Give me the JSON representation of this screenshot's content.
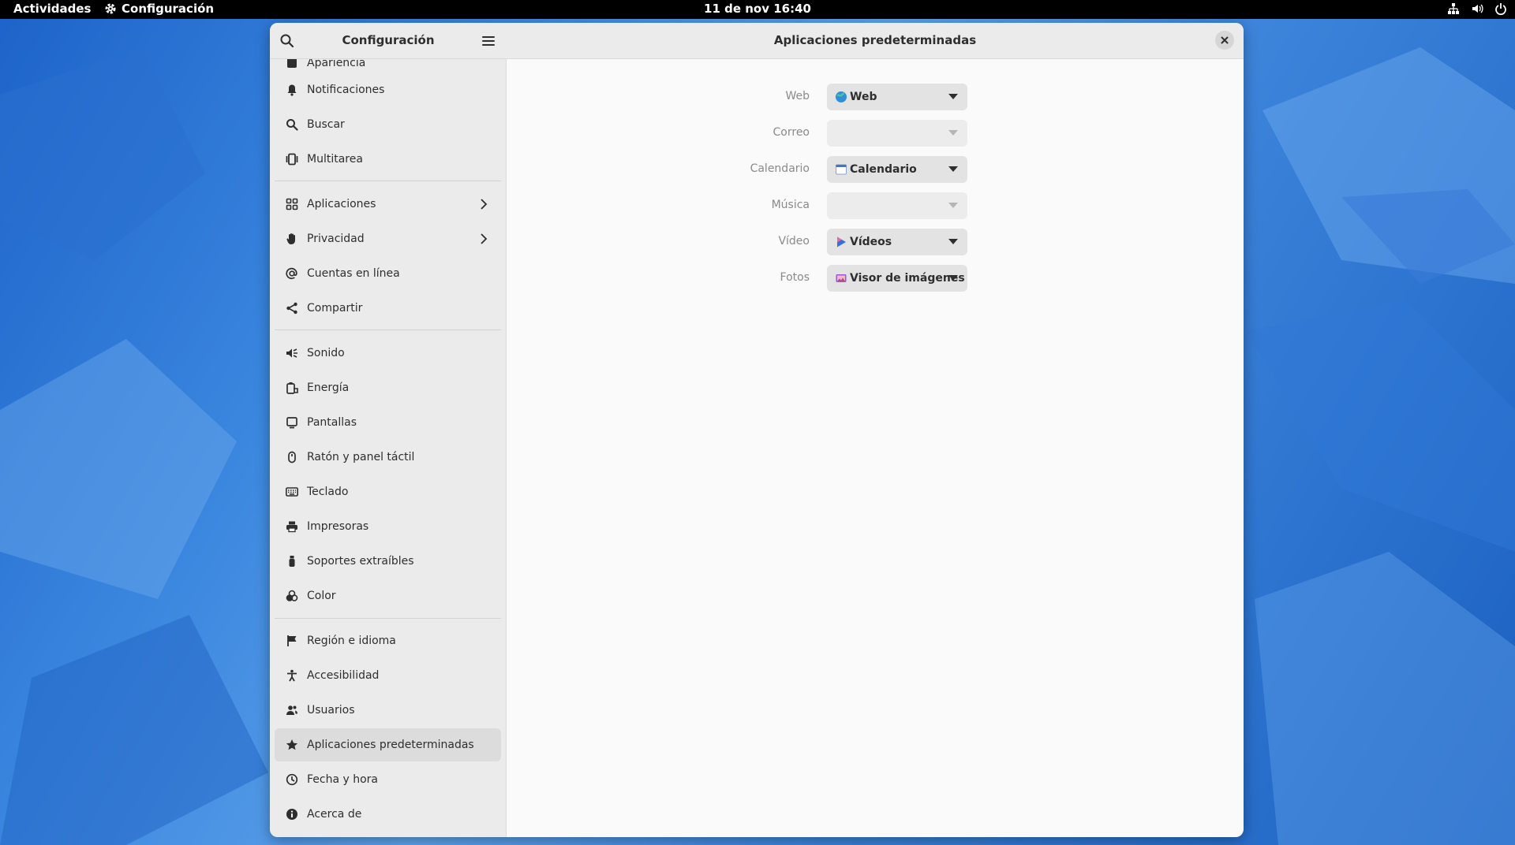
{
  "topbar": {
    "activities": "Actividades",
    "app_name": "Configuración",
    "clock": "11 de nov  16:40"
  },
  "sidebar": {
    "title": "Configuración",
    "items": [
      {
        "label": "Apariencia",
        "icon": "palette-icon"
      },
      {
        "label": "Notificaciones",
        "icon": "bell-icon"
      },
      {
        "label": "Buscar",
        "icon": "search-icon"
      },
      {
        "label": "Multitarea",
        "icon": "multitasking-icon"
      },
      {
        "label": "Aplicaciones",
        "icon": "apps-grid-icon"
      },
      {
        "label": "Privacidad",
        "icon": "hand-icon"
      },
      {
        "label": "Cuentas en línea",
        "icon": "at-icon"
      },
      {
        "label": "Compartir",
        "icon": "share-icon"
      },
      {
        "label": "Sonido",
        "icon": "speaker-icon"
      },
      {
        "label": "Energía",
        "icon": "battery-icon"
      },
      {
        "label": "Pantallas",
        "icon": "display-icon"
      },
      {
        "label": "Ratón y panel táctil",
        "icon": "mouse-icon"
      },
      {
        "label": "Teclado",
        "icon": "keyboard-icon"
      },
      {
        "label": "Impresoras",
        "icon": "printer-icon"
      },
      {
        "label": "Soportes extraíbles",
        "icon": "usb-icon"
      },
      {
        "label": "Color",
        "icon": "color-icon"
      },
      {
        "label": "Región e idioma",
        "icon": "flag-icon"
      },
      {
        "label": "Accesibilidad",
        "icon": "accessibility-icon"
      },
      {
        "label": "Usuarios",
        "icon": "users-icon"
      },
      {
        "label": "Aplicaciones predeterminadas",
        "icon": "star-icon"
      },
      {
        "label": "Fecha y hora",
        "icon": "clock-icon"
      },
      {
        "label": "Acerca de",
        "icon": "info-icon"
      }
    ],
    "selected": "Aplicaciones predeterminadas"
  },
  "content": {
    "title": "Aplicaciones predeterminadas",
    "rows": [
      {
        "label": "Web",
        "value": "Web",
        "enabled": true,
        "icon": "globe-icon"
      },
      {
        "label": "Correo",
        "value": "",
        "enabled": false
      },
      {
        "label": "Calendario",
        "value": "Calendario",
        "enabled": true,
        "icon": "calendar-icon"
      },
      {
        "label": "Música",
        "value": "",
        "enabled": false
      },
      {
        "label": "Vídeo",
        "value": "Vídeos",
        "enabled": true,
        "icon": "video-play-icon"
      },
      {
        "label": "Fotos",
        "value": "Visor de imágenes",
        "enabled": true,
        "icon": "image-viewer-icon"
      }
    ]
  },
  "colors": {
    "accent": "#3584e4",
    "desktop_blue": "#3b87df"
  }
}
